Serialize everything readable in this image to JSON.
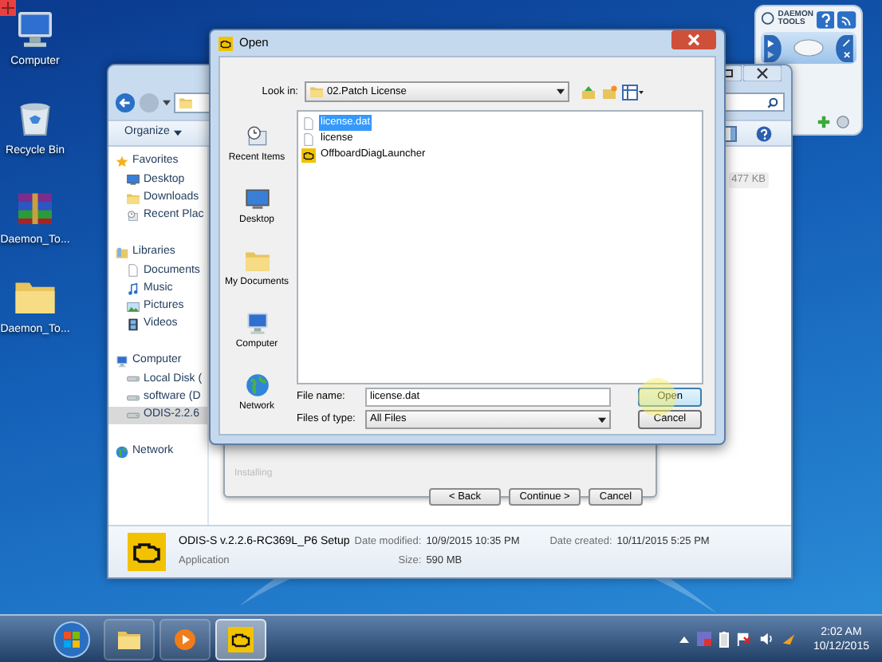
{
  "desktop_icons": [
    {
      "label": "Computer",
      "kind": "computer"
    },
    {
      "label": "Recycle Bin",
      "kind": "trash"
    },
    {
      "label": "Daemon_To...",
      "kind": "archive"
    },
    {
      "label": "Daemon_To...",
      "kind": "folder"
    }
  ],
  "gadget": {
    "brand": "DAEMON TOOLS"
  },
  "explorer": {
    "organize": "Organize",
    "nav_groups": [
      {
        "label": "Favorites",
        "kind": "star",
        "items": [
          {
            "label": "Desktop",
            "kind": "monitor",
            "selected": false
          },
          {
            "label": "Downloads",
            "kind": "folder",
            "selected": false
          },
          {
            "label": "Recent Plac",
            "kind": "recent",
            "selected": false
          }
        ]
      },
      {
        "label": "Libraries",
        "kind": "library",
        "items": [
          {
            "label": "Documents",
            "kind": "document",
            "selected": false
          },
          {
            "label": "Music",
            "kind": "music",
            "selected": false
          },
          {
            "label": "Pictures",
            "kind": "image",
            "selected": false
          },
          {
            "label": "Videos",
            "kind": "film",
            "selected": false
          }
        ]
      },
      {
        "label": "Computer",
        "kind": "computer",
        "items": [
          {
            "label": "Local Disk (",
            "kind": "drive",
            "selected": false
          },
          {
            "label": "software (D",
            "kind": "drive",
            "selected": false
          },
          {
            "label": "ODIS-2.2.6",
            "kind": "drive",
            "selected": true
          }
        ]
      },
      {
        "label": "Network",
        "kind": "globe"
      }
    ],
    "column_size": "477 KB",
    "details": {
      "kind": "engine",
      "name": "ODIS-S v.2.2.6-RC369L_P6 Setup",
      "type": "Application",
      "modified_label": "Date modified:",
      "modified": "10/9/2015 10:35 PM",
      "created_label": "Date created:",
      "created": "10/11/2015 5:25 PM",
      "size_label": "Size:",
      "size": "590 MB"
    }
  },
  "wizard": {
    "status": "Installing",
    "buttons": [
      "< Back",
      "Continue >",
      "Cancel"
    ]
  },
  "open_dialog": {
    "title": "Open",
    "look_in_label": "Look in:",
    "look_in": "02.Patch License",
    "places": [
      {
        "label": "Recent Items",
        "kind": "recent"
      },
      {
        "label": "Desktop",
        "kind": "monitor"
      },
      {
        "label": "My Documents",
        "kind": "folder"
      },
      {
        "label": "Computer",
        "kind": "computer"
      },
      {
        "label": "Network",
        "kind": "globe"
      }
    ],
    "files": [
      {
        "name": "license.dat",
        "kind": "document",
        "selected": true
      },
      {
        "name": "license",
        "kind": "document",
        "selected": false
      },
      {
        "name": "OffboardDiagLauncher",
        "kind": "engine",
        "selected": false
      }
    ],
    "file_name_label": "File name:",
    "file_name": "license.dat",
    "type_label": "Files of type:",
    "type": "All Files",
    "buttons": [
      {
        "label": "Open",
        "default": true
      },
      {
        "label": "Cancel",
        "default": false
      }
    ]
  },
  "taskbar": {
    "apps": [
      {
        "kind": "folder",
        "active": false
      },
      {
        "kind": "media",
        "active": false
      },
      {
        "kind": "engine",
        "active": true
      }
    ],
    "time": "2:02 AM",
    "date": "10/12/2015"
  }
}
